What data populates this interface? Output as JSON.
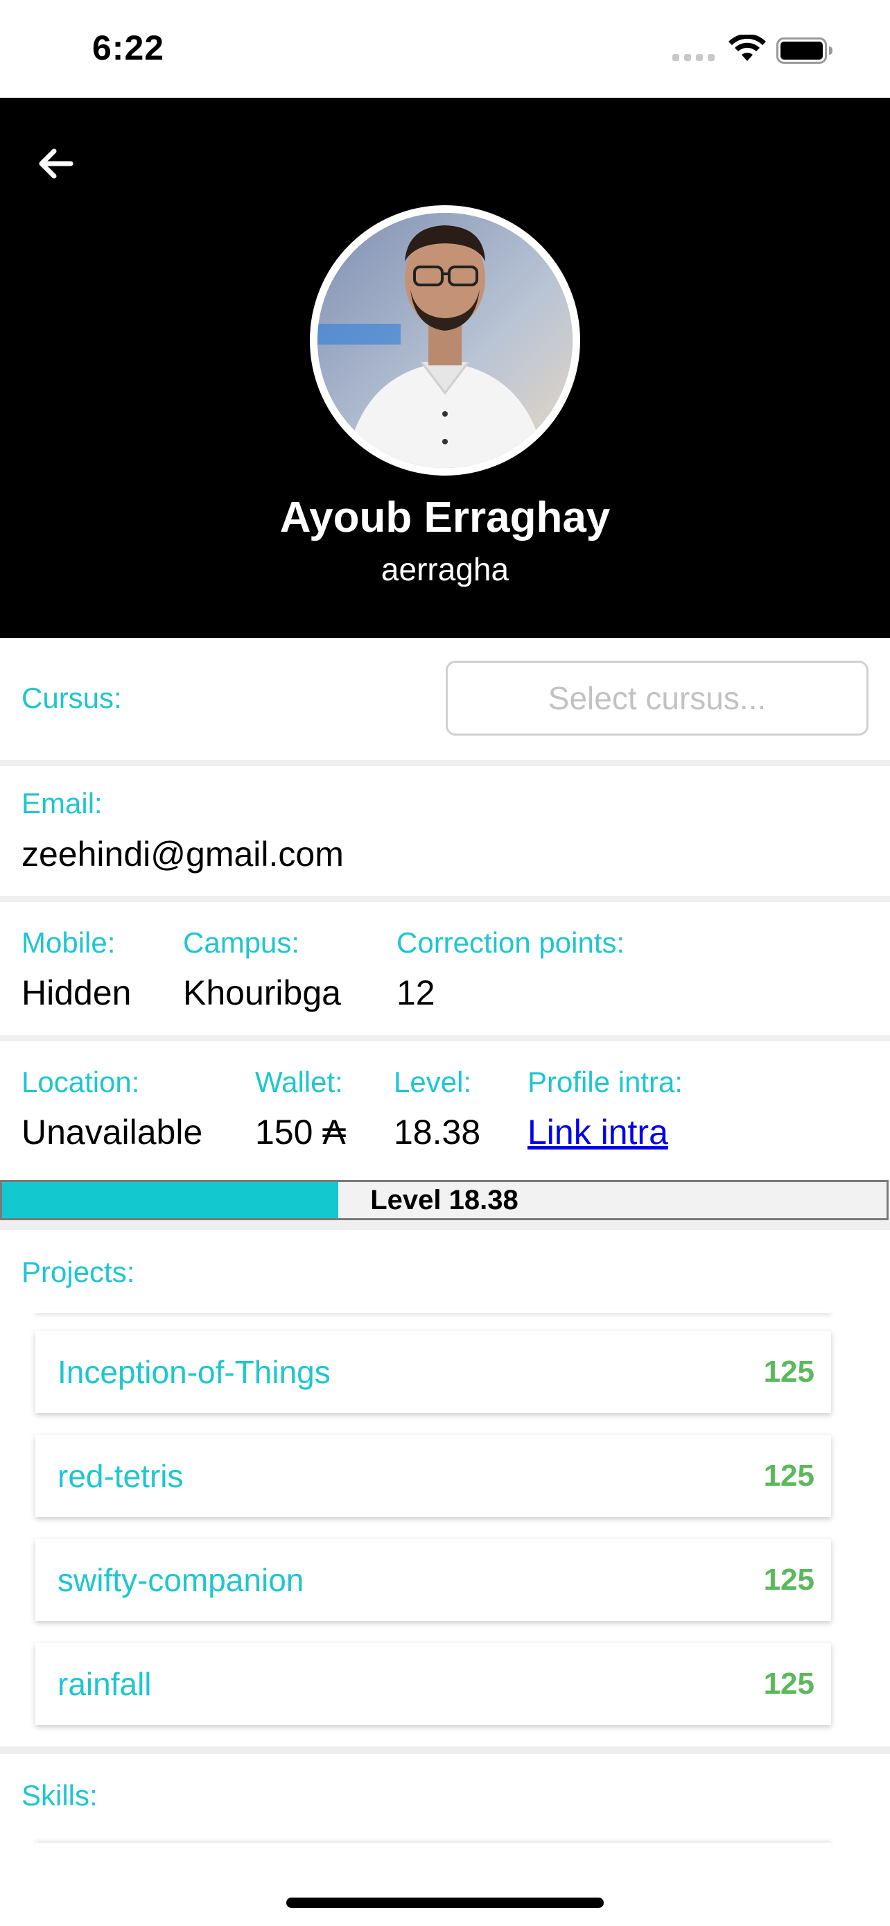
{
  "status_bar": {
    "time": "6:22"
  },
  "profile": {
    "full_name": "Ayoub Erraghay",
    "login": "aerragha"
  },
  "cursus": {
    "label": "Cursus:",
    "placeholder": "Select cursus..."
  },
  "email": {
    "label": "Email:",
    "value": "zeehindi@gmail.com"
  },
  "info_row_1": {
    "mobile_label": "Mobile:",
    "mobile_value": "Hidden",
    "campus_label": "Campus:",
    "campus_value": "Khouribga",
    "correction_label": "Correction points:",
    "correction_value": "12"
  },
  "info_row_2": {
    "location_label": "Location:",
    "location_value": "Unavailable",
    "wallet_label": "Wallet:",
    "wallet_value": "150 ₳",
    "level_label": "Level:",
    "level_value": "18.38",
    "profile_label": "Profile intra:",
    "profile_link": "Link intra"
  },
  "level_bar": {
    "text": "Level 18.38",
    "progress": 0.38
  },
  "projects": {
    "label": "Projects:",
    "items": [
      {
        "name": "Inception-of-Things",
        "mark": "125"
      },
      {
        "name": "red-tetris",
        "mark": "125"
      },
      {
        "name": "swifty-companion",
        "mark": "125"
      },
      {
        "name": "rainfall",
        "mark": "125"
      }
    ]
  },
  "skills": {
    "label": "Skills:"
  },
  "colors": {
    "accent": "#1ec6cf",
    "mark": "#5cb85c",
    "header_bg": "#000000"
  }
}
